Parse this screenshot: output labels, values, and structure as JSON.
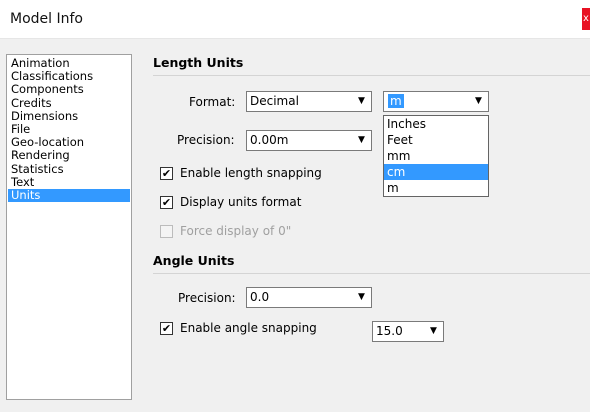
{
  "window": {
    "title": "Model Info",
    "close_glyph": "x"
  },
  "sidebar": {
    "items": [
      {
        "label": "Animation"
      },
      {
        "label": "Classifications"
      },
      {
        "label": "Components"
      },
      {
        "label": "Credits"
      },
      {
        "label": "Dimensions"
      },
      {
        "label": "File"
      },
      {
        "label": "Geo-location"
      },
      {
        "label": "Rendering"
      },
      {
        "label": "Statistics"
      },
      {
        "label": "Text"
      },
      {
        "label": "Units"
      }
    ],
    "selected": "Units"
  },
  "length_units": {
    "title": "Length Units",
    "format_label": "Format:",
    "format_value": "Decimal",
    "unit_value": "m",
    "unit_dropdown_open": true,
    "unit_options": [
      "Inches",
      "Feet",
      "mm",
      "cm",
      "m"
    ],
    "unit_highlighted_option": "cm",
    "precision_label": "Precision:",
    "precision_value": "0.00m",
    "enable_snapping_label": "Enable length snapping",
    "enable_snapping_checked": true,
    "display_format_label": "Display units format",
    "display_format_checked": true,
    "force_zero_label": "Force display of 0\"",
    "force_zero_checked": false,
    "force_zero_enabled": false
  },
  "angle_units": {
    "title": "Angle Units",
    "precision_label": "Precision:",
    "precision_value": "0.0",
    "enable_snapping_label": "Enable angle snapping",
    "enable_snapping_checked": true,
    "snap_value": "15.0"
  },
  "icons": {
    "dropdown_arrow": "▼",
    "check": "✔"
  },
  "colors": {
    "selection": "#3399ff",
    "close_button": "#e81123",
    "dialog_background": "#f0f0f0"
  }
}
